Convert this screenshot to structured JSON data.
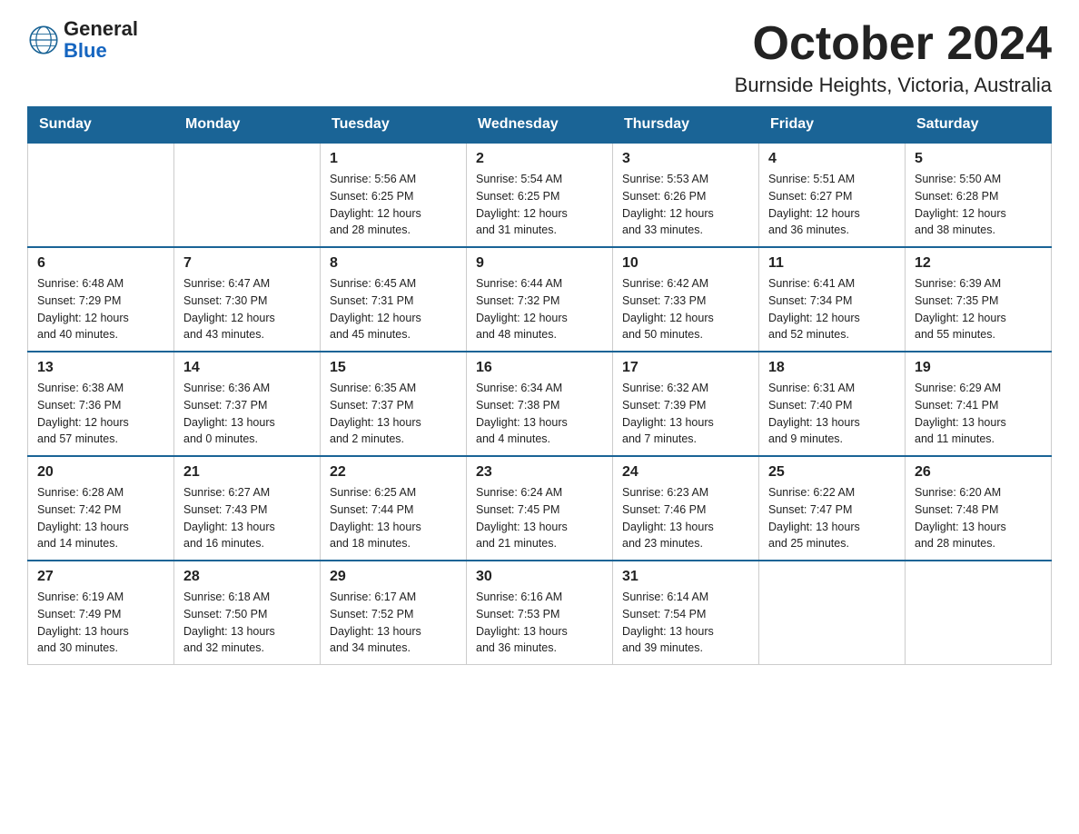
{
  "header": {
    "logo_general": "General",
    "logo_blue": "Blue",
    "title": "October 2024",
    "subtitle": "Burnside Heights, Victoria, Australia"
  },
  "calendar": {
    "days_of_week": [
      "Sunday",
      "Monday",
      "Tuesday",
      "Wednesday",
      "Thursday",
      "Friday",
      "Saturday"
    ],
    "weeks": [
      [
        {
          "day": "",
          "info": ""
        },
        {
          "day": "",
          "info": ""
        },
        {
          "day": "1",
          "info": "Sunrise: 5:56 AM\nSunset: 6:25 PM\nDaylight: 12 hours\nand 28 minutes."
        },
        {
          "day": "2",
          "info": "Sunrise: 5:54 AM\nSunset: 6:25 PM\nDaylight: 12 hours\nand 31 minutes."
        },
        {
          "day": "3",
          "info": "Sunrise: 5:53 AM\nSunset: 6:26 PM\nDaylight: 12 hours\nand 33 minutes."
        },
        {
          "day": "4",
          "info": "Sunrise: 5:51 AM\nSunset: 6:27 PM\nDaylight: 12 hours\nand 36 minutes."
        },
        {
          "day": "5",
          "info": "Sunrise: 5:50 AM\nSunset: 6:28 PM\nDaylight: 12 hours\nand 38 minutes."
        }
      ],
      [
        {
          "day": "6",
          "info": "Sunrise: 6:48 AM\nSunset: 7:29 PM\nDaylight: 12 hours\nand 40 minutes."
        },
        {
          "day": "7",
          "info": "Sunrise: 6:47 AM\nSunset: 7:30 PM\nDaylight: 12 hours\nand 43 minutes."
        },
        {
          "day": "8",
          "info": "Sunrise: 6:45 AM\nSunset: 7:31 PM\nDaylight: 12 hours\nand 45 minutes."
        },
        {
          "day": "9",
          "info": "Sunrise: 6:44 AM\nSunset: 7:32 PM\nDaylight: 12 hours\nand 48 minutes."
        },
        {
          "day": "10",
          "info": "Sunrise: 6:42 AM\nSunset: 7:33 PM\nDaylight: 12 hours\nand 50 minutes."
        },
        {
          "day": "11",
          "info": "Sunrise: 6:41 AM\nSunset: 7:34 PM\nDaylight: 12 hours\nand 52 minutes."
        },
        {
          "day": "12",
          "info": "Sunrise: 6:39 AM\nSunset: 7:35 PM\nDaylight: 12 hours\nand 55 minutes."
        }
      ],
      [
        {
          "day": "13",
          "info": "Sunrise: 6:38 AM\nSunset: 7:36 PM\nDaylight: 12 hours\nand 57 minutes."
        },
        {
          "day": "14",
          "info": "Sunrise: 6:36 AM\nSunset: 7:37 PM\nDaylight: 13 hours\nand 0 minutes."
        },
        {
          "day": "15",
          "info": "Sunrise: 6:35 AM\nSunset: 7:37 PM\nDaylight: 13 hours\nand 2 minutes."
        },
        {
          "day": "16",
          "info": "Sunrise: 6:34 AM\nSunset: 7:38 PM\nDaylight: 13 hours\nand 4 minutes."
        },
        {
          "day": "17",
          "info": "Sunrise: 6:32 AM\nSunset: 7:39 PM\nDaylight: 13 hours\nand 7 minutes."
        },
        {
          "day": "18",
          "info": "Sunrise: 6:31 AM\nSunset: 7:40 PM\nDaylight: 13 hours\nand 9 minutes."
        },
        {
          "day": "19",
          "info": "Sunrise: 6:29 AM\nSunset: 7:41 PM\nDaylight: 13 hours\nand 11 minutes."
        }
      ],
      [
        {
          "day": "20",
          "info": "Sunrise: 6:28 AM\nSunset: 7:42 PM\nDaylight: 13 hours\nand 14 minutes."
        },
        {
          "day": "21",
          "info": "Sunrise: 6:27 AM\nSunset: 7:43 PM\nDaylight: 13 hours\nand 16 minutes."
        },
        {
          "day": "22",
          "info": "Sunrise: 6:25 AM\nSunset: 7:44 PM\nDaylight: 13 hours\nand 18 minutes."
        },
        {
          "day": "23",
          "info": "Sunrise: 6:24 AM\nSunset: 7:45 PM\nDaylight: 13 hours\nand 21 minutes."
        },
        {
          "day": "24",
          "info": "Sunrise: 6:23 AM\nSunset: 7:46 PM\nDaylight: 13 hours\nand 23 minutes."
        },
        {
          "day": "25",
          "info": "Sunrise: 6:22 AM\nSunset: 7:47 PM\nDaylight: 13 hours\nand 25 minutes."
        },
        {
          "day": "26",
          "info": "Sunrise: 6:20 AM\nSunset: 7:48 PM\nDaylight: 13 hours\nand 28 minutes."
        }
      ],
      [
        {
          "day": "27",
          "info": "Sunrise: 6:19 AM\nSunset: 7:49 PM\nDaylight: 13 hours\nand 30 minutes."
        },
        {
          "day": "28",
          "info": "Sunrise: 6:18 AM\nSunset: 7:50 PM\nDaylight: 13 hours\nand 32 minutes."
        },
        {
          "day": "29",
          "info": "Sunrise: 6:17 AM\nSunset: 7:52 PM\nDaylight: 13 hours\nand 34 minutes."
        },
        {
          "day": "30",
          "info": "Sunrise: 6:16 AM\nSunset: 7:53 PM\nDaylight: 13 hours\nand 36 minutes."
        },
        {
          "day": "31",
          "info": "Sunrise: 6:14 AM\nSunset: 7:54 PM\nDaylight: 13 hours\nand 39 minutes."
        },
        {
          "day": "",
          "info": ""
        },
        {
          "day": "",
          "info": ""
        }
      ]
    ]
  }
}
